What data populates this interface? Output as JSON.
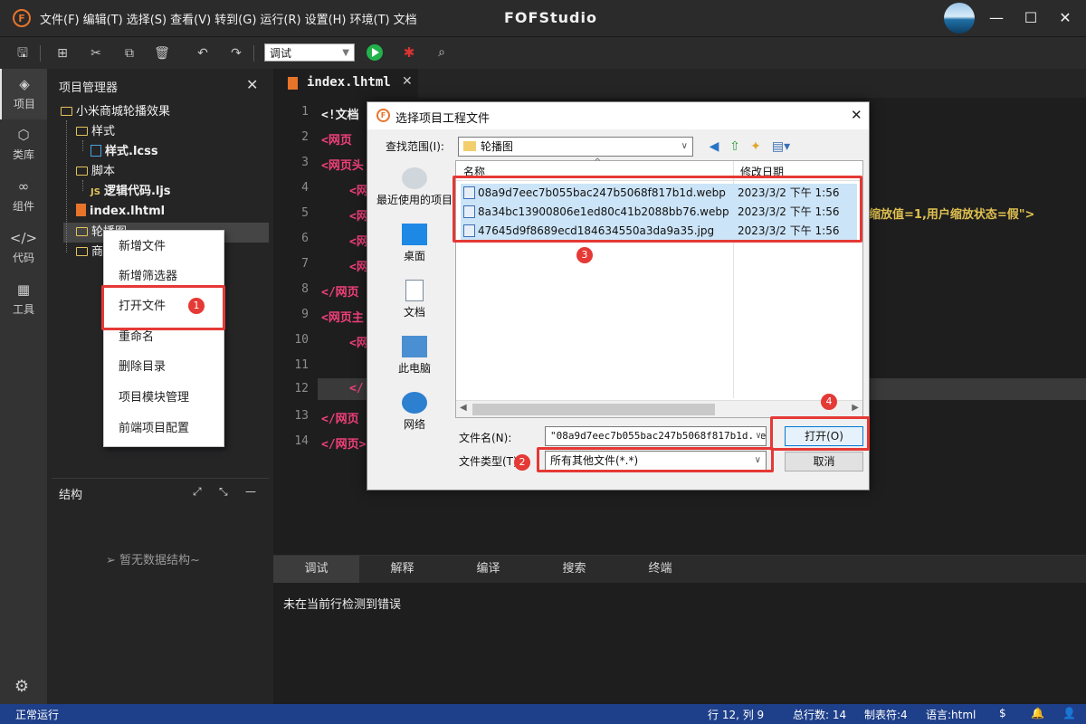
{
  "titlebar": {
    "menus": [
      "文件(F)",
      "编辑(T)",
      "选择(S)",
      "查看(V)",
      "转到(G)",
      "运行(R)",
      "设置(H)",
      "环境(T)",
      "文档"
    ],
    "app_title": "FOFStudio",
    "logo_text": "F"
  },
  "toolbar": {
    "mode_value": "调试"
  },
  "activity": {
    "items": [
      {
        "label": "项目",
        "icon": "layers-icon"
      },
      {
        "label": "类库",
        "icon": "cube-icon"
      },
      {
        "label": "组件",
        "icon": "link-icon"
      },
      {
        "label": "代码",
        "icon": "code-icon"
      },
      {
        "label": "工具",
        "icon": "grid-icon"
      }
    ]
  },
  "sidebar": {
    "title": "项目管理器",
    "tree": {
      "root": "小米商城轮播效果",
      "style_folder": "样式",
      "style_file": "样式.lcss",
      "script_folder": "脚本",
      "script_file": "逻辑代码.ljs",
      "index_file": "index.lhtml",
      "selected_folder": "轮播图",
      "last_folder": "商"
    },
    "structure_title": "结构",
    "structure_empty": "暂无数据结构~"
  },
  "context_menu": {
    "items": [
      "新增文件",
      "新增筛选器",
      "打开文件",
      "重命名",
      "删除目录",
      "项目模块管理",
      "前端项目配置"
    ]
  },
  "editor": {
    "tab_label": "index.lhtml",
    "lines": [
      {
        "num": "1",
        "text": "<!文档"
      },
      {
        "num": "2",
        "text": "<网页"
      },
      {
        "num": "3",
        "text": "<网页头"
      },
      {
        "num": "4",
        "text": "<网"
      },
      {
        "num": "5",
        "text": "<网"
      },
      {
        "num": "6",
        "text": "<网"
      },
      {
        "num": "7",
        "text": "<网"
      },
      {
        "num": "8",
        "text": "</网页"
      },
      {
        "num": "9",
        "text": "<网页主"
      },
      {
        "num": "10",
        "text": "<网"
      },
      {
        "num": "11",
        "text": ""
      },
      {
        "num": "12",
        "text": "</"
      },
      {
        "num": "13",
        "text": "</网页"
      },
      {
        "num": "14",
        "text": "</网页>"
      }
    ],
    "visible_right_text": "缩放值=1,用户缩放状态=假\">"
  },
  "bottom_panel": {
    "tabs": [
      "调试",
      "解释",
      "编译",
      "搜索",
      "终端"
    ],
    "message": "未在当前行检测到错误"
  },
  "statusbar": {
    "left": "正常运行",
    "position": "行 12, 列 9",
    "total_lines": "总行数: 14",
    "tab_size": "制表符:4",
    "language": "语言:html"
  },
  "dialog": {
    "title": "选择项目工程文件",
    "look_in_label": "查找范围(I):",
    "look_in_value": "轮播图",
    "places": [
      "最近使用的项目",
      "桌面",
      "文档",
      "此电脑",
      "网络"
    ],
    "columns": {
      "name": "名称",
      "date": "修改日期"
    },
    "files": [
      {
        "name": "08a9d7eec7b055bac247b5068f817b1d.webp",
        "date": "2023/3/2 下午 1:56"
      },
      {
        "name": "8a34bc13900806e1ed80c41b2088bb76.webp",
        "date": "2023/3/2 下午 1:56"
      },
      {
        "name": "47645d9f8689ecd184634550a3da9a35.jpg",
        "date": "2023/3/2 下午 1:56"
      }
    ],
    "filename_label": "文件名(N):",
    "filename_value": "\"08a9d7eec7b055bac247b5068f817b1d.web",
    "filetype_label": "文件类型(T):",
    "filetype_value": "所有其他文件(*.*)",
    "open_button": "打开(O)",
    "cancel_button": "取消"
  },
  "annotations": [
    "1",
    "2",
    "3",
    "4"
  ],
  "colors": {
    "accent": "#e8742a",
    "statusbar": "#1e3f8a",
    "annotation": "#e53935",
    "keyword": "#f0407a"
  }
}
